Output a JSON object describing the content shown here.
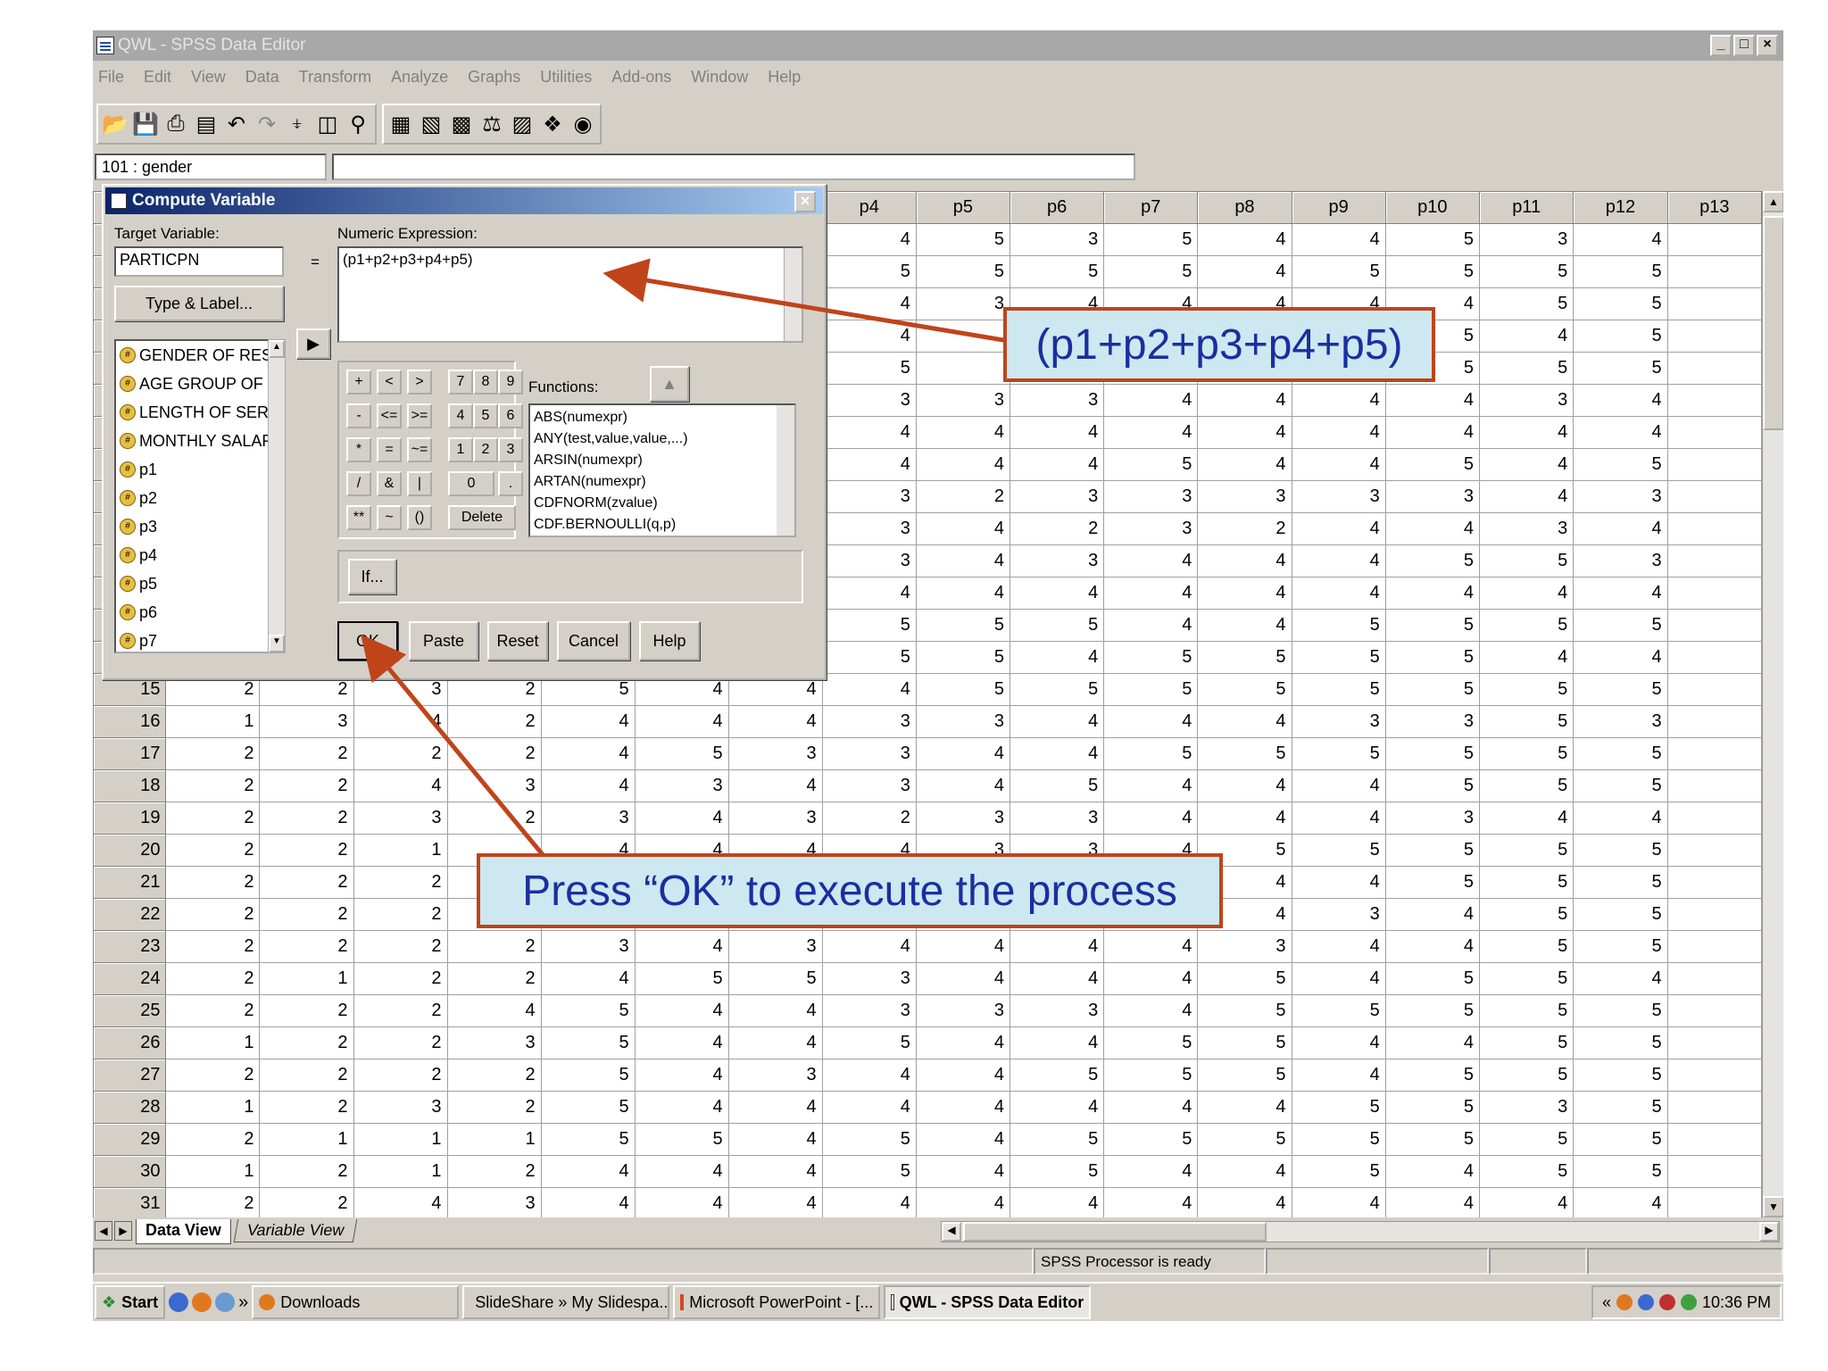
{
  "window": {
    "title": "QWL - SPSS Data Editor"
  },
  "menu": [
    "File",
    "Edit",
    "View",
    "Data",
    "Transform",
    "Analyze",
    "Graphs",
    "Utilities",
    "Add-ons",
    "Window",
    "Help"
  ],
  "cell_ref": "101 : gender",
  "grid": {
    "columns": [
      "",
      "",
      "",
      "",
      "",
      "",
      "",
      "",
      "p4",
      "p5",
      "p6",
      "p7",
      "p8",
      "p9",
      "p10",
      "p11",
      "p12",
      "p13"
    ],
    "rows": [
      {
        "n": "",
        "v": [
          "",
          "",
          "",
          "",
          "",
          "",
          "",
          "4",
          "5",
          "3",
          "5",
          "4",
          "4",
          "5",
          "3",
          "4",
          ""
        ]
      },
      {
        "n": "",
        "v": [
          "",
          "",
          "",
          "",
          "",
          "",
          "",
          "5",
          "5",
          "5",
          "5",
          "4",
          "5",
          "5",
          "5",
          "5",
          ""
        ]
      },
      {
        "n": "",
        "v": [
          "",
          "",
          "",
          "",
          "",
          "",
          "",
          "4",
          "3",
          "4",
          "4",
          "4",
          "4",
          "4",
          "5",
          "5",
          ""
        ]
      },
      {
        "n": "",
        "v": [
          "",
          "",
          "",
          "",
          "",
          "",
          "",
          "4",
          "",
          "",
          "",
          "",
          "",
          "5",
          "4",
          "5",
          ""
        ]
      },
      {
        "n": "",
        "v": [
          "",
          "",
          "",
          "",
          "",
          "",
          "",
          "5",
          "",
          "",
          "",
          "",
          "",
          "5",
          "5",
          "5",
          ""
        ]
      },
      {
        "n": "",
        "v": [
          "",
          "",
          "",
          "",
          "",
          "",
          "",
          "3",
          "3",
          "3",
          "4",
          "4",
          "4",
          "4",
          "3",
          "4",
          ""
        ]
      },
      {
        "n": "",
        "v": [
          "",
          "",
          "",
          "",
          "",
          "",
          "",
          "4",
          "4",
          "4",
          "4",
          "4",
          "4",
          "4",
          "4",
          "4",
          ""
        ]
      },
      {
        "n": "",
        "v": [
          "",
          "",
          "",
          "",
          "",
          "",
          "",
          "4",
          "4",
          "4",
          "5",
          "4",
          "4",
          "5",
          "4",
          "5",
          ""
        ]
      },
      {
        "n": "",
        "v": [
          "",
          "",
          "",
          "",
          "",
          "",
          "",
          "3",
          "2",
          "3",
          "3",
          "3",
          "3",
          "3",
          "4",
          "3",
          ""
        ]
      },
      {
        "n": "",
        "v": [
          "",
          "",
          "",
          "",
          "",
          "",
          "",
          "3",
          "4",
          "2",
          "3",
          "2",
          "4",
          "4",
          "3",
          "4",
          ""
        ]
      },
      {
        "n": "",
        "v": [
          "",
          "",
          "",
          "",
          "",
          "",
          "",
          "3",
          "4",
          "3",
          "4",
          "4",
          "4",
          "5",
          "5",
          "3",
          ""
        ]
      },
      {
        "n": "",
        "v": [
          "",
          "",
          "",
          "",
          "",
          "",
          "",
          "4",
          "4",
          "4",
          "4",
          "4",
          "4",
          "4",
          "4",
          "4",
          ""
        ]
      },
      {
        "n": "",
        "v": [
          "",
          "",
          "",
          "",
          "",
          "",
          "",
          "5",
          "5",
          "5",
          "4",
          "4",
          "5",
          "5",
          "5",
          "5",
          ""
        ]
      },
      {
        "n": "",
        "v": [
          "",
          "",
          "",
          "",
          "",
          "",
          "",
          "5",
          "5",
          "4",
          "5",
          "5",
          "5",
          "5",
          "4",
          "4",
          ""
        ]
      },
      {
        "n": "15",
        "v": [
          "2",
          "2",
          "3",
          "2",
          "5",
          "4",
          "4",
          "4",
          "5",
          "5",
          "5",
          "5",
          "5",
          "5",
          "5",
          "5",
          ""
        ]
      },
      {
        "n": "16",
        "v": [
          "1",
          "3",
          "4",
          "2",
          "4",
          "4",
          "4",
          "3",
          "3",
          "4",
          "4",
          "4",
          "3",
          "3",
          "5",
          "3",
          ""
        ]
      },
      {
        "n": "17",
        "v": [
          "2",
          "2",
          "2",
          "2",
          "4",
          "5",
          "3",
          "3",
          "4",
          "4",
          "5",
          "5",
          "5",
          "5",
          "5",
          "5",
          ""
        ]
      },
      {
        "n": "18",
        "v": [
          "2",
          "2",
          "4",
          "3",
          "4",
          "3",
          "4",
          "3",
          "4",
          "5",
          "4",
          "4",
          "4",
          "5",
          "5",
          "5",
          ""
        ]
      },
      {
        "n": "19",
        "v": [
          "2",
          "2",
          "3",
          "2",
          "3",
          "4",
          "3",
          "2",
          "3",
          "3",
          "4",
          "4",
          "4",
          "3",
          "4",
          "4",
          ""
        ]
      },
      {
        "n": "20",
        "v": [
          "2",
          "2",
          "1",
          "",
          "4",
          "4",
          "4",
          "4",
          "3",
          "3",
          "4",
          "5",
          "5",
          "5",
          "5",
          "5",
          ""
        ]
      },
      {
        "n": "21",
        "v": [
          "2",
          "2",
          "2",
          "",
          "",
          "",
          "",
          "",
          "",
          "",
          "",
          "4",
          "4",
          "5",
          "5",
          "5",
          ""
        ]
      },
      {
        "n": "22",
        "v": [
          "2",
          "2",
          "2",
          "",
          "",
          "",
          "",
          "",
          "",
          "",
          "",
          "4",
          "3",
          "4",
          "5",
          "5",
          ""
        ]
      },
      {
        "n": "23",
        "v": [
          "2",
          "2",
          "2",
          "2",
          "3",
          "4",
          "3",
          "4",
          "4",
          "4",
          "4",
          "3",
          "4",
          "4",
          "5",
          "5",
          ""
        ]
      },
      {
        "n": "24",
        "v": [
          "2",
          "1",
          "2",
          "2",
          "4",
          "5",
          "5",
          "3",
          "4",
          "4",
          "4",
          "5",
          "4",
          "5",
          "5",
          "4",
          ""
        ]
      },
      {
        "n": "25",
        "v": [
          "2",
          "2",
          "2",
          "4",
          "5",
          "4",
          "4",
          "3",
          "3",
          "3",
          "4",
          "5",
          "5",
          "5",
          "5",
          "5",
          ""
        ]
      },
      {
        "n": "26",
        "v": [
          "1",
          "2",
          "2",
          "3",
          "5",
          "4",
          "4",
          "5",
          "4",
          "4",
          "5",
          "5",
          "4",
          "4",
          "5",
          "5",
          ""
        ]
      },
      {
        "n": "27",
        "v": [
          "2",
          "2",
          "2",
          "2",
          "5",
          "4",
          "3",
          "4",
          "4",
          "5",
          "5",
          "5",
          "4",
          "5",
          "5",
          "5",
          ""
        ]
      },
      {
        "n": "28",
        "v": [
          "1",
          "2",
          "3",
          "2",
          "5",
          "4",
          "4",
          "4",
          "4",
          "4",
          "4",
          "4",
          "5",
          "5",
          "3",
          "5",
          ""
        ]
      },
      {
        "n": "29",
        "v": [
          "2",
          "1",
          "1",
          "1",
          "5",
          "5",
          "4",
          "5",
          "4",
          "5",
          "5",
          "5",
          "5",
          "5",
          "5",
          "5",
          ""
        ]
      },
      {
        "n": "30",
        "v": [
          "1",
          "2",
          "1",
          "2",
          "4",
          "4",
          "4",
          "5",
          "4",
          "5",
          "4",
          "4",
          "5",
          "4",
          "5",
          "5",
          ""
        ]
      },
      {
        "n": "31",
        "v": [
          "2",
          "2",
          "4",
          "3",
          "4",
          "4",
          "4",
          "4",
          "4",
          "4",
          "4",
          "4",
          "4",
          "4",
          "4",
          "4",
          ""
        ]
      }
    ]
  },
  "tabs": {
    "data_view": "Data View",
    "variable_view": "Variable View"
  },
  "status": {
    "processor": "SPSS Processor  is ready"
  },
  "taskbar": {
    "start": "Start",
    "items": [
      "Downloads",
      "SlideShare » My Slidespa...",
      "Microsoft PowerPoint - [...",
      "QWL - SPSS Data Editor"
    ],
    "more": "»",
    "tray_more": "«",
    "clock": "10:36 PM"
  },
  "dialog": {
    "title": "Compute Variable",
    "target_label": "Target Variable:",
    "target_value": "PARTICPN",
    "equals": "=",
    "expr_label": "Numeric Expression:",
    "expr_value": "(p1+p2+p3+p4+p5)",
    "type_label_button": "Type & Label...",
    "variables": [
      "GENDER OF RESI",
      "AGE GROUP OF R",
      "LENGTH OF SERV",
      "MONTHLY SALAR",
      "p1",
      "p2",
      "p3",
      "p4",
      "p5",
      "p6",
      "p7"
    ],
    "keypad": [
      [
        "+",
        "<",
        ">",
        "7",
        "8",
        "9"
      ],
      [
        "-",
        "<=",
        ">=",
        "4",
        "5",
        "6"
      ],
      [
        "*",
        "=",
        "~=",
        "1",
        "2",
        "3"
      ],
      [
        "/",
        "&",
        "|",
        "0",
        "."
      ],
      [
        "**",
        "~",
        "()",
        "Delete"
      ]
    ],
    "functions_label": "Functions:",
    "functions": [
      "ABS(numexpr)",
      "ANY(test,value,value,...)",
      "ARSIN(numexpr)",
      "ARTAN(numexpr)",
      "CDFNORM(zvalue)",
      "CDF.BERNOULLI(q,p)"
    ],
    "if_button": "If...",
    "buttons": {
      "ok": "OK",
      "paste": "Paste",
      "reset": "Reset",
      "cancel": "Cancel",
      "help": "Help"
    }
  },
  "callouts": {
    "expression": "(p1+p2+p3+p4+p5)",
    "ok_hint": "Press “OK” to execute the process"
  },
  "colors": {
    "callout_border": "#c0441a",
    "callout_fill": "#cde8f0",
    "callout_text": "#1a2fa0",
    "title_bar": "#0a246a"
  }
}
